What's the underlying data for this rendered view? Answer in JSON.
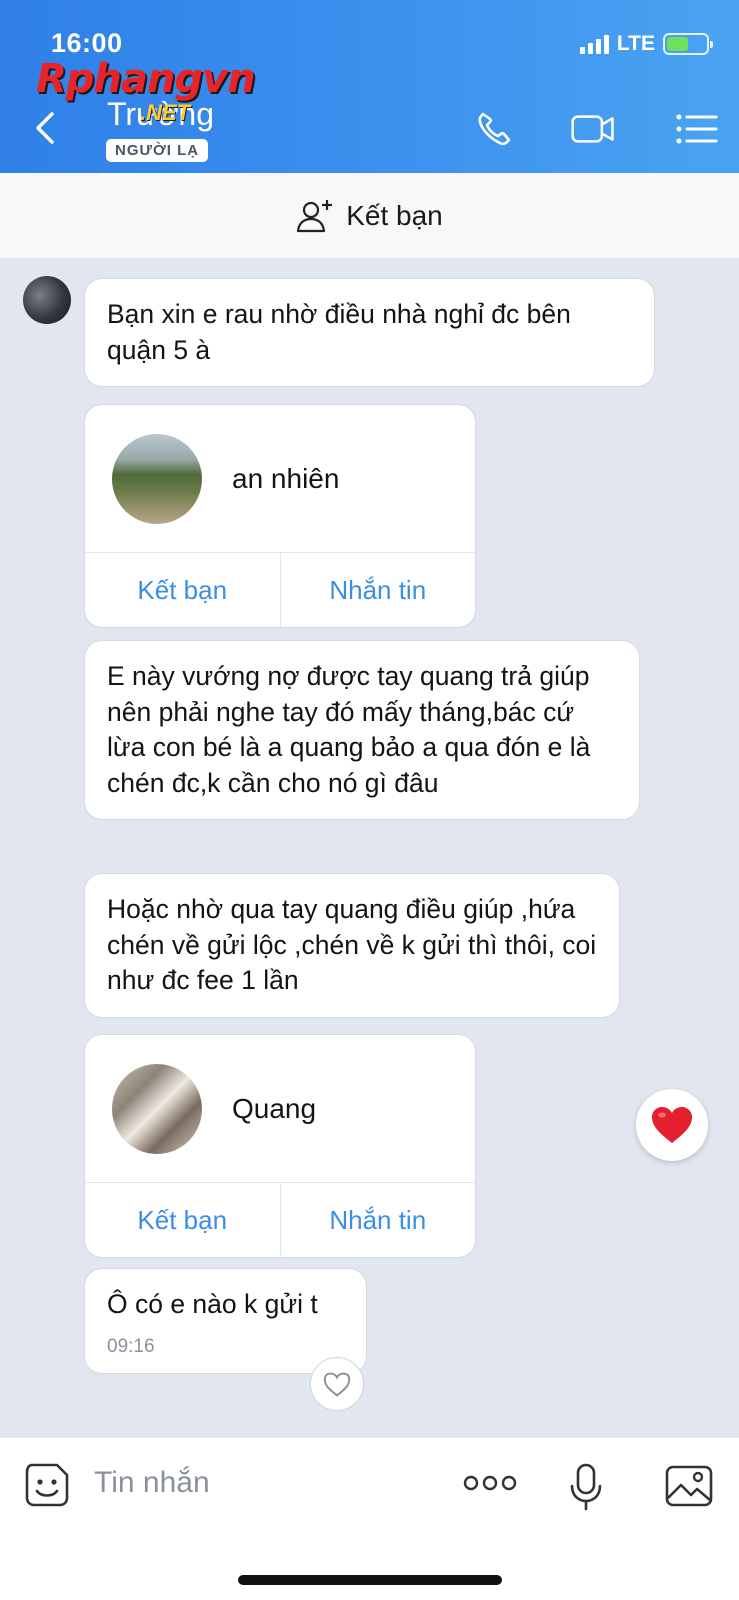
{
  "status": {
    "time": "16:00",
    "network": "LTE"
  },
  "watermark": {
    "main": "Rphangvn",
    "sub": ".NET"
  },
  "header": {
    "contact_name": "Trường",
    "badge": "NGƯỜI LẠ"
  },
  "add_friend_bar": {
    "label": "Kết bạn"
  },
  "messages": [
    {
      "type": "text",
      "text": "Bạn xin e rau nhờ điều nhà nghỉ đc bên quận 5 à"
    },
    {
      "type": "contact_card",
      "name": "an nhiên",
      "add_label": "Kết bạn",
      "message_label": "Nhắn tin"
    },
    {
      "type": "text",
      "text": "E này vướng nợ được tay quang trả giúp nên phải nghe tay đó mấy tháng,bác cứ lừa con bé là a quang bảo a qua đón e là chén đc,k cần cho nó gì đâu"
    },
    {
      "type": "text",
      "text": "Hoặc nhờ qua tay quang điều giúp ,hứa chén về gửi lộc ,chén về k gửi thì thôi, coi như đc fee 1 lần"
    },
    {
      "type": "contact_card",
      "name": "Quang",
      "add_label": "Kết bạn",
      "message_label": "Nhắn tin"
    },
    {
      "type": "text",
      "text": "Ô có e nào k gửi t",
      "time": "09:16"
    }
  ],
  "input": {
    "placeholder": "Tin nhắn"
  },
  "icons": {
    "back": "back-chevron-icon",
    "call": "phone-icon",
    "video": "video-camera-icon",
    "menu": "list-menu-icon",
    "add_friend": "add-user-icon",
    "emoji": "sticker-icon",
    "more": "more-dots-icon",
    "mic": "microphone-icon",
    "image": "image-icon",
    "reaction": "heart-icon"
  },
  "colors": {
    "header_start": "#2f7fe8",
    "header_end": "#4aa3f2",
    "link_blue": "#3a8ee8",
    "chat_bg": "#e2e6ee",
    "heart_red": "#e5202e"
  }
}
